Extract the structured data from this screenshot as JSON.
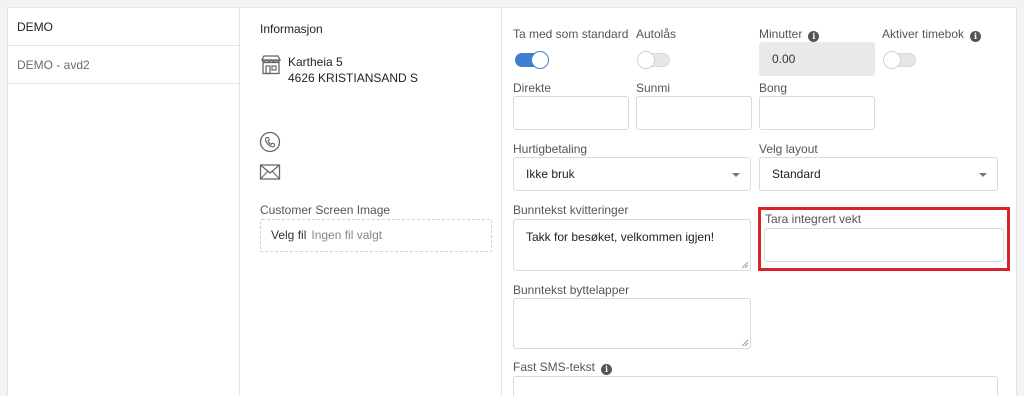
{
  "sidebar": {
    "items": [
      {
        "label": "DEMO"
      },
      {
        "label": "DEMO - avd2"
      }
    ]
  },
  "info": {
    "title": "Informasjon",
    "address_line1": "Kartheia 5",
    "address_line2": "4626 KRISTIANSAND S",
    "address_icon": "store-icon",
    "phone_icon": "phone-icon",
    "mail_icon": "mail-icon",
    "customer_screen_label": "Customer Screen Image",
    "file_button_label": "Velg fil",
    "file_status": "Ingen fil valgt"
  },
  "form": {
    "ta_med": {
      "label": "Ta med som standard",
      "on": true
    },
    "autolas": {
      "label": "Autolås",
      "on": false
    },
    "minutter": {
      "label": "Minutter",
      "value": "0.00"
    },
    "timebok": {
      "label": "Aktiver timebok",
      "on": false
    },
    "direkte": {
      "label": "Direkte",
      "value": ""
    },
    "sunmi": {
      "label": "Sunmi",
      "value": ""
    },
    "bong": {
      "label": "Bong",
      "value": ""
    },
    "hurtigbetaling": {
      "label": "Hurtigbetaling",
      "selected": "Ikke bruk"
    },
    "layout": {
      "label": "Velg layout",
      "selected": "Standard"
    },
    "bunntekst_kvitt": {
      "label": "Bunntekst kvitteringer",
      "value": "Takk for besøket, velkommen igjen!"
    },
    "tara": {
      "label": "Tara integrert vekt",
      "value": ""
    },
    "bunntekst_bytte": {
      "label": "Bunntekst byttelapper",
      "value": ""
    },
    "sms": {
      "label": "Fast SMS-tekst",
      "value": ""
    }
  },
  "colors": {
    "toggle_on": "#3f7fd1",
    "highlight": "#d9232a"
  }
}
